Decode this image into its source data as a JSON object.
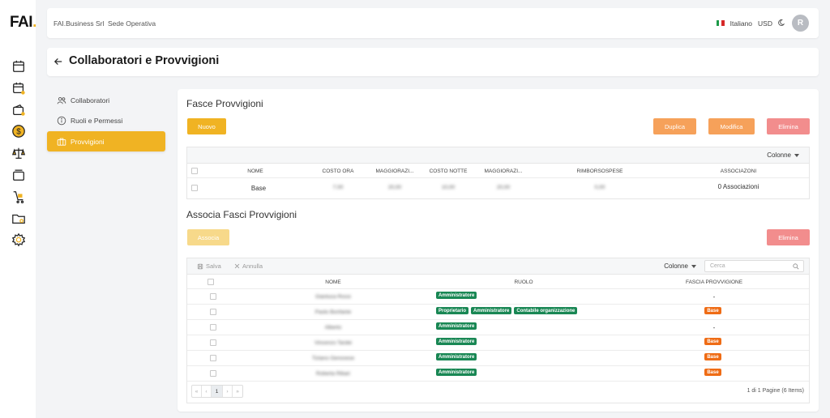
{
  "logo": {
    "text": "FAI",
    "dot": "."
  },
  "topbar": {
    "company": "FAI.Business Srl",
    "location": "Sede Operativa",
    "language": "Italiano",
    "currency": "USD",
    "avatar_initial": "R"
  },
  "page": {
    "title": "Collaboratori e Provvigioni"
  },
  "sidebar": {
    "items": [
      {
        "label": "Collaboratori",
        "icon": "users-icon"
      },
      {
        "label": "Ruoli e Permessi",
        "icon": "info-icon"
      },
      {
        "label": "Provvigioni",
        "icon": "briefcase-icon",
        "active": true
      }
    ]
  },
  "fasce": {
    "title": "Fasce Provvigioni",
    "btn_new": "Nuovo",
    "btn_duplicate": "Duplica",
    "btn_edit": "Modifica",
    "btn_delete": "Elimina",
    "columns_label": "Colonne",
    "headers": [
      "NOME",
      "COSTO ORA",
      "MAGGIORAZI...",
      "COSTO NOTTE",
      "MAGGIORAZI...",
      "RIMBORSOSPESE",
      "ASSOCIAZONI"
    ],
    "rows": [
      {
        "nome": "Base",
        "costo_ora": "7,00",
        "magg1": "20,00",
        "costo_notte": "10,00",
        "magg2": "20,00",
        "rimborso": "0,00",
        "associazioni": "0 Associazioni"
      }
    ]
  },
  "associa": {
    "title": "Associa Fasci Provvigioni",
    "btn_associate": "Associa",
    "btn_delete": "Elimina",
    "save_label": "Salva",
    "cancel_label": "Annulla",
    "columns_label": "Colonne",
    "search_placeholder": "Cerca",
    "headers": [
      "NOME",
      "RUOLO",
      "FASCIA PROVVIGIONE"
    ],
    "rows": [
      {
        "nome": "Gianluca Rossi",
        "ruoli": [
          "Amministratore"
        ],
        "fascia": "-"
      },
      {
        "nome": "Paolo Bonfante",
        "ruoli": [
          "Proprietario",
          "Amministratore",
          "Contabile organizzazione"
        ],
        "fascia": "Base"
      },
      {
        "nome": "Alberto",
        "ruoli": [
          "Amministratore"
        ],
        "fascia": "-"
      },
      {
        "nome": "Vincenzo Tardei",
        "ruoli": [
          "Amministratore"
        ],
        "fascia": "Base"
      },
      {
        "nome": "Tiziano Genovese",
        "ruoli": [
          "Amministratore"
        ],
        "fascia": "Base"
      },
      {
        "nome": "Roberta Ribari",
        "ruoli": [
          "Amministratore"
        ],
        "fascia": "Base"
      }
    ],
    "pagination": {
      "first": "«",
      "prev": "‹",
      "current": "1",
      "next": "›",
      "last": "»",
      "summary": "1 di 1 Pagine (6 Items)"
    }
  },
  "colors": {
    "accent": "#f0b323",
    "orange": "#f6a15a",
    "danger": "#f28d8d",
    "role_tag": "#198754",
    "fascia_tag": "#ef6c15"
  }
}
